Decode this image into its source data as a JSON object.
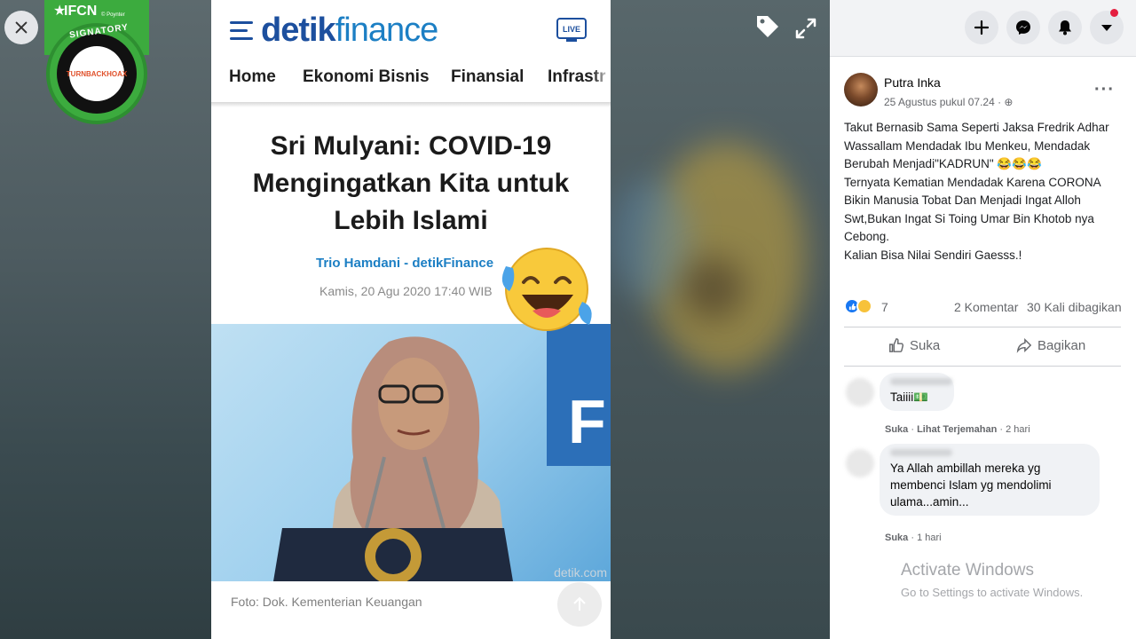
{
  "badge": {
    "title": "IFCN",
    "subtitle": "© Poynter",
    "ring_text": "SIGNATORY",
    "core_text": "TURNBACKHOAX"
  },
  "article": {
    "logo_part1": "detik",
    "logo_part2": "finance",
    "live_label": "LIVE",
    "nav": [
      "Home",
      "Ekonomi Bisnis",
      "Finansial",
      "Infrastr"
    ],
    "headline_lines": [
      "Sri Mulyani: COVID-19",
      "Mengingatkan Kita untuk",
      "Lebih Islami"
    ],
    "byline": "Trio Hamdani - detikFinance",
    "date": "Kamis, 20 Agu 2020 17:40 WIB",
    "photo_board_text": "F",
    "photo_watermark": "detik.com",
    "caption": "Foto: Dok. Kementerian Keuangan"
  },
  "facebook": {
    "author": "Putra Inka",
    "post_date": "25 Agustus pukul 07.24 · ⊕",
    "post_lines": [
      "Takut Bernasib Sama Seperti Jaksa Fredrik Adhar",
      "Wassallam Mendadak Ibu Menkeu, Mendadak",
      "Berubah Menjadi\"KADRUN\" 😂😂😂",
      "Ternyata Kematian Mendadak Karena CORONA",
      "Bikin Manusia Tobat Dan Menjadi Ingat Alloh",
      "Swt,Bukan Ingat Si Toing Umar Bin Khotob nya",
      "Cebong.",
      "Kalian Bisa Nilai Sendiri Gaesss.!"
    ],
    "reaction_count": "7",
    "comments_count": "2 Komentar",
    "shares_count": "30 Kali dibagikan",
    "like_label": "Suka",
    "share_label": "Bagikan",
    "comments": [
      {
        "text": "Taiiii💵",
        "meta_like": "Suka",
        "meta_translate": "Lihat Terjemahan",
        "meta_time": "2 hari"
      },
      {
        "text_lines": [
          "Ya Allah ambillah mereka yg",
          "membenci Islam yg mendolimi",
          "ulama...amin..."
        ],
        "meta_like": "Suka",
        "meta_time": "1 hari"
      }
    ],
    "activate_title": "Activate Windows",
    "activate_sub": "Go to Settings to activate Windows."
  },
  "colors": {
    "detik_blue": "#1c4f9e",
    "detik_light": "#1c7fc4",
    "fb_blue": "#1877f2",
    "ifcn_green": "#3cab3e"
  },
  "icons": [
    "close-icon",
    "tag-icon",
    "expand-icon",
    "plus-icon",
    "messenger-icon",
    "bell-icon",
    "caret-down-icon",
    "like-icon",
    "share-icon",
    "live-icon",
    "hamburger-icon",
    "arrow-up-icon"
  ]
}
